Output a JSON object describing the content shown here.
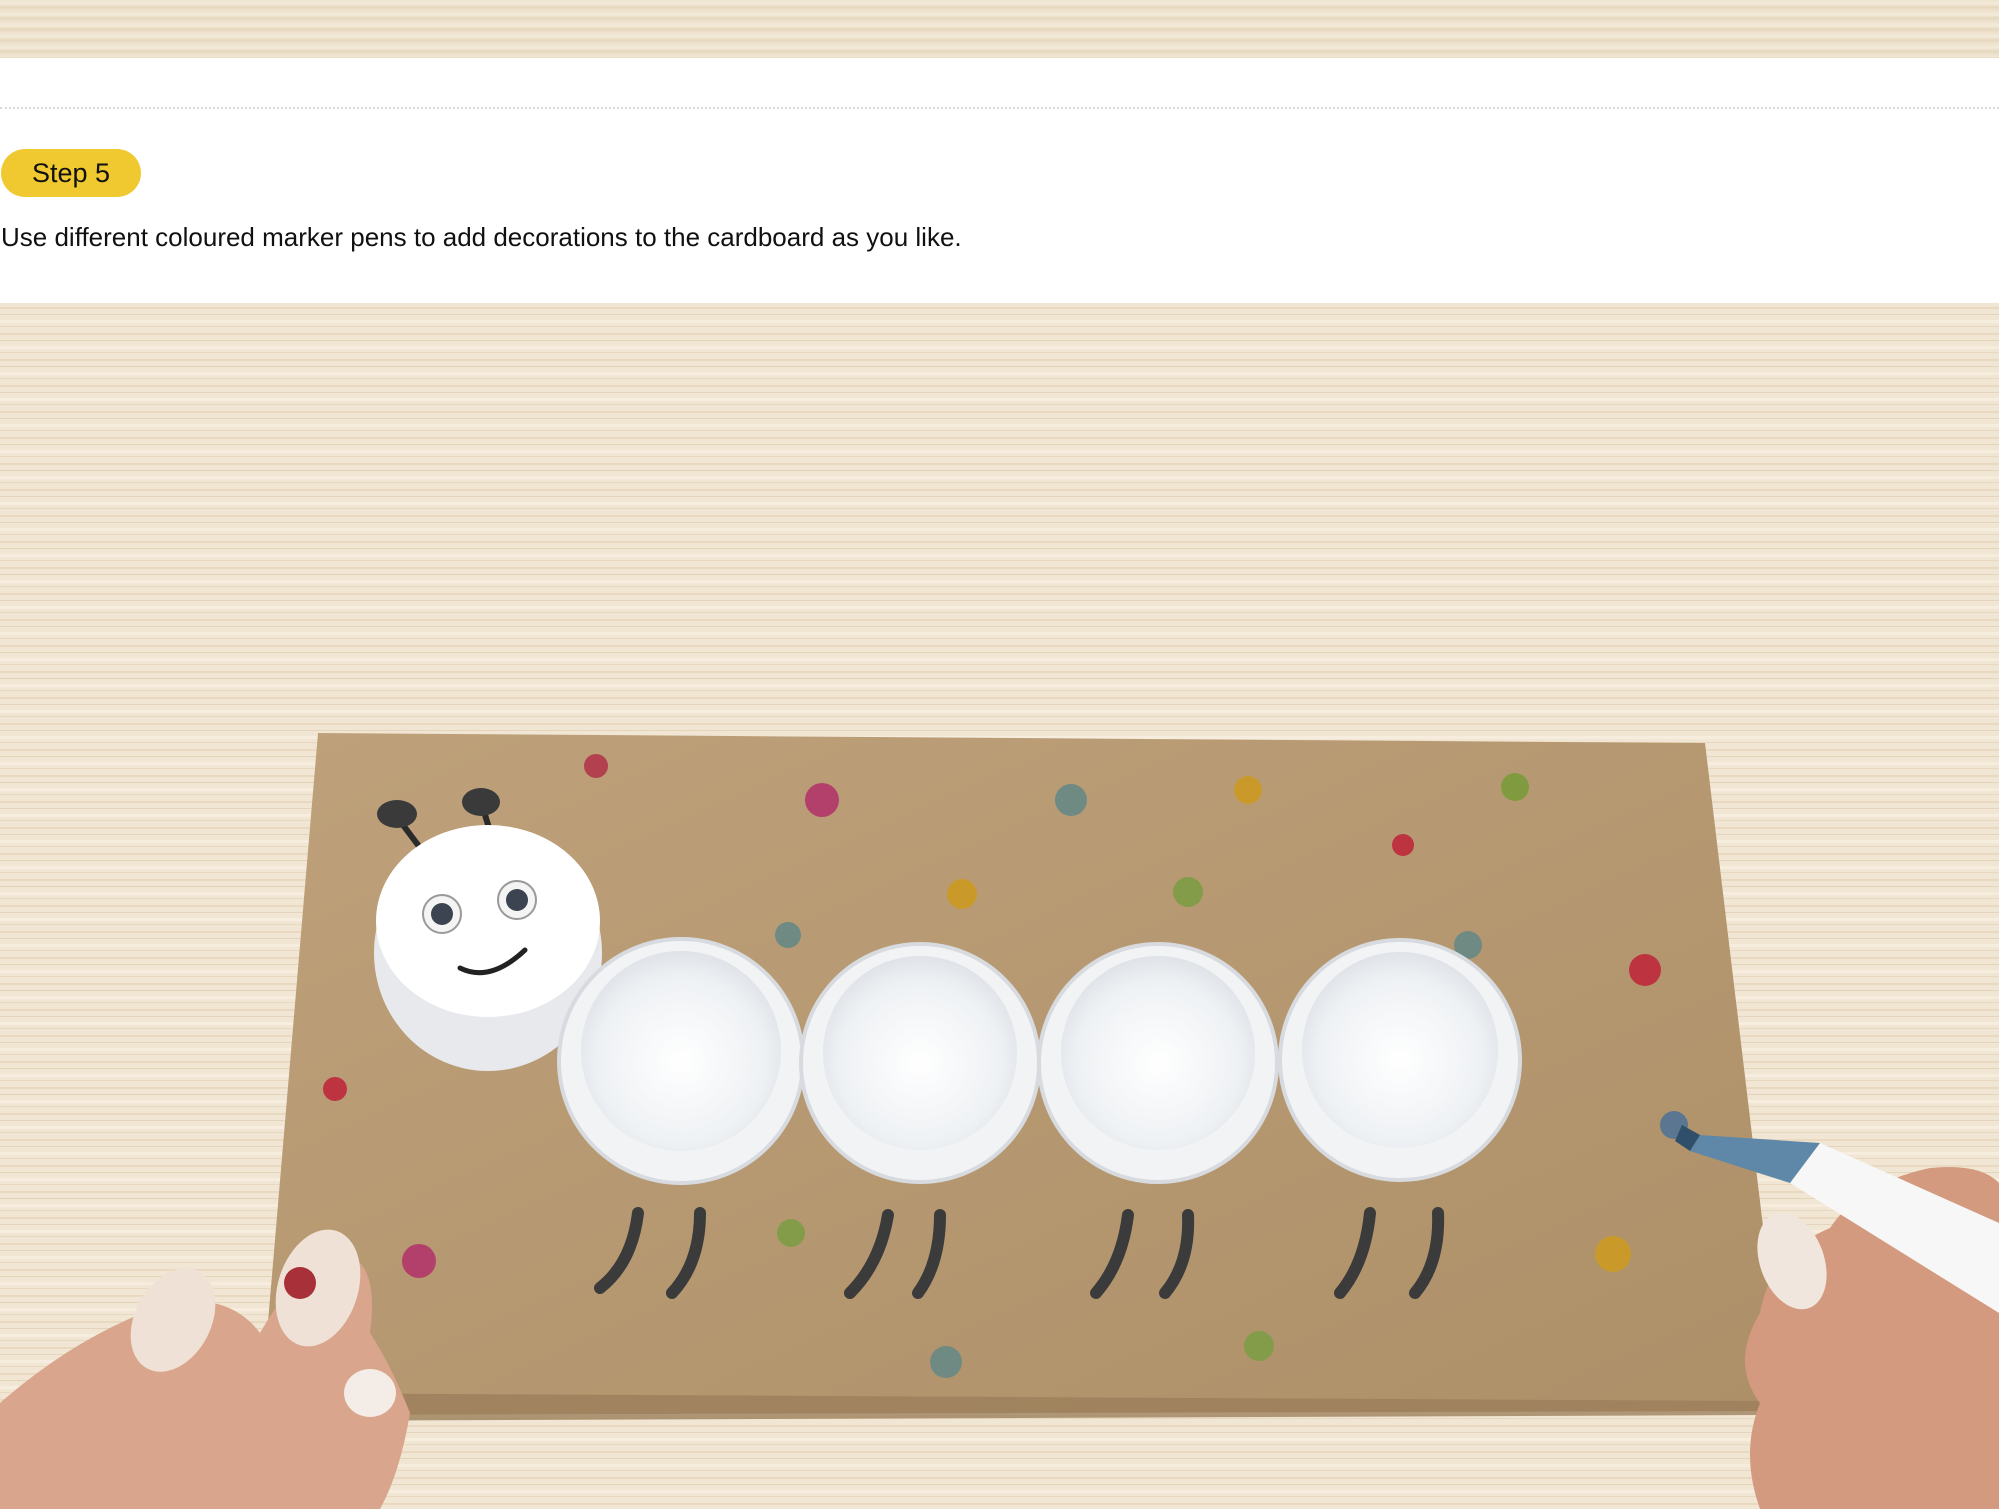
{
  "step": {
    "label": "Step 5",
    "instruction": "Use different coloured marker pens to add decorations to the cardboard as you like."
  },
  "colors": {
    "badge": "#efc92f",
    "wood": "#f0e4d0",
    "cardboard": "#b89a73",
    "caps": "#ffffff"
  },
  "photo": {
    "subject": "caterpillar craft made from five white bottle caps on cardboard with coloured dots, hand holding a marker"
  }
}
